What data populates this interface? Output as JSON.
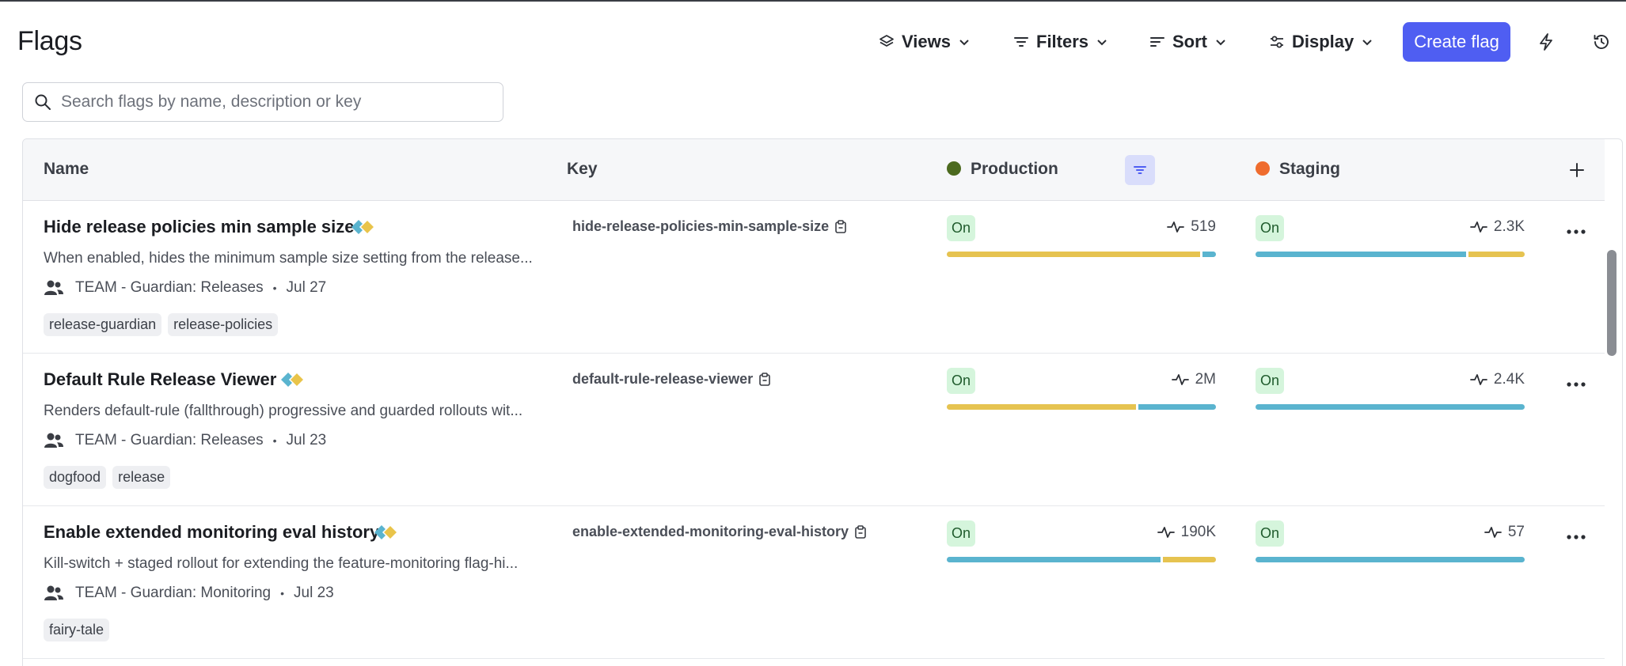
{
  "header": {
    "title": "Flags",
    "views_label": "Views",
    "filters_label": "Filters",
    "sort_label": "Sort",
    "display_label": "Display",
    "create_label": "Create flag",
    "accent_color": "#4f5ef2"
  },
  "search": {
    "placeholder": "Search flags by name, description or key",
    "value": ""
  },
  "table": {
    "columns": {
      "name": "Name",
      "key": "Key",
      "production": "Production",
      "staging": "Staging"
    },
    "env_colors": {
      "production": "#4c6a1f",
      "staging": "#ef6c2e"
    },
    "rows": [
      {
        "name": "Hide release policies min sample size",
        "description": "When enabled, hides the minimum sample size setting from the release...",
        "team": "TEAM - Guardian: Releases",
        "date": "Jul 27",
        "tags": [
          "release-guardian",
          "release-policies"
        ],
        "key": "hide-release-policies-min-sample-size",
        "production": {
          "status": "On",
          "evaluations": "519",
          "yellow_share": 0.95,
          "blue_share": 0.05
        },
        "staging": {
          "status": "On",
          "evaluations": "2.3K",
          "blue_share": 0.79,
          "yellow_share": 0.21
        }
      },
      {
        "name": "Default Rule Release Viewer",
        "description": "Renders default-rule (fallthrough) progressive and guarded rollouts wit...",
        "team": "TEAM - Guardian: Releases",
        "date": "Jul 23",
        "tags": [
          "dogfood",
          "release"
        ],
        "key": "default-rule-release-viewer",
        "production": {
          "status": "On",
          "evaluations": "2M",
          "yellow_share": 0.71,
          "blue_share": 0.29
        },
        "staging": {
          "status": "On",
          "evaluations": "2.4K",
          "blue_share": 1.0,
          "yellow_share": 0.0
        }
      },
      {
        "name": "Enable extended monitoring eval history",
        "description": "Kill-switch + staged rollout for extending the feature-monitoring flag-hi...",
        "team": "TEAM - Guardian: Monitoring",
        "date": "Jul 23",
        "tags": [
          "fairy-tale"
        ],
        "key": "enable-extended-monitoring-eval-history",
        "production": {
          "status": "On",
          "evaluations": "190K",
          "blue_share": 0.8,
          "yellow_share": 0.2
        },
        "staging": {
          "status": "On",
          "evaluations": "57",
          "blue_share": 1.0,
          "yellow_share": 0.0
        }
      }
    ]
  }
}
